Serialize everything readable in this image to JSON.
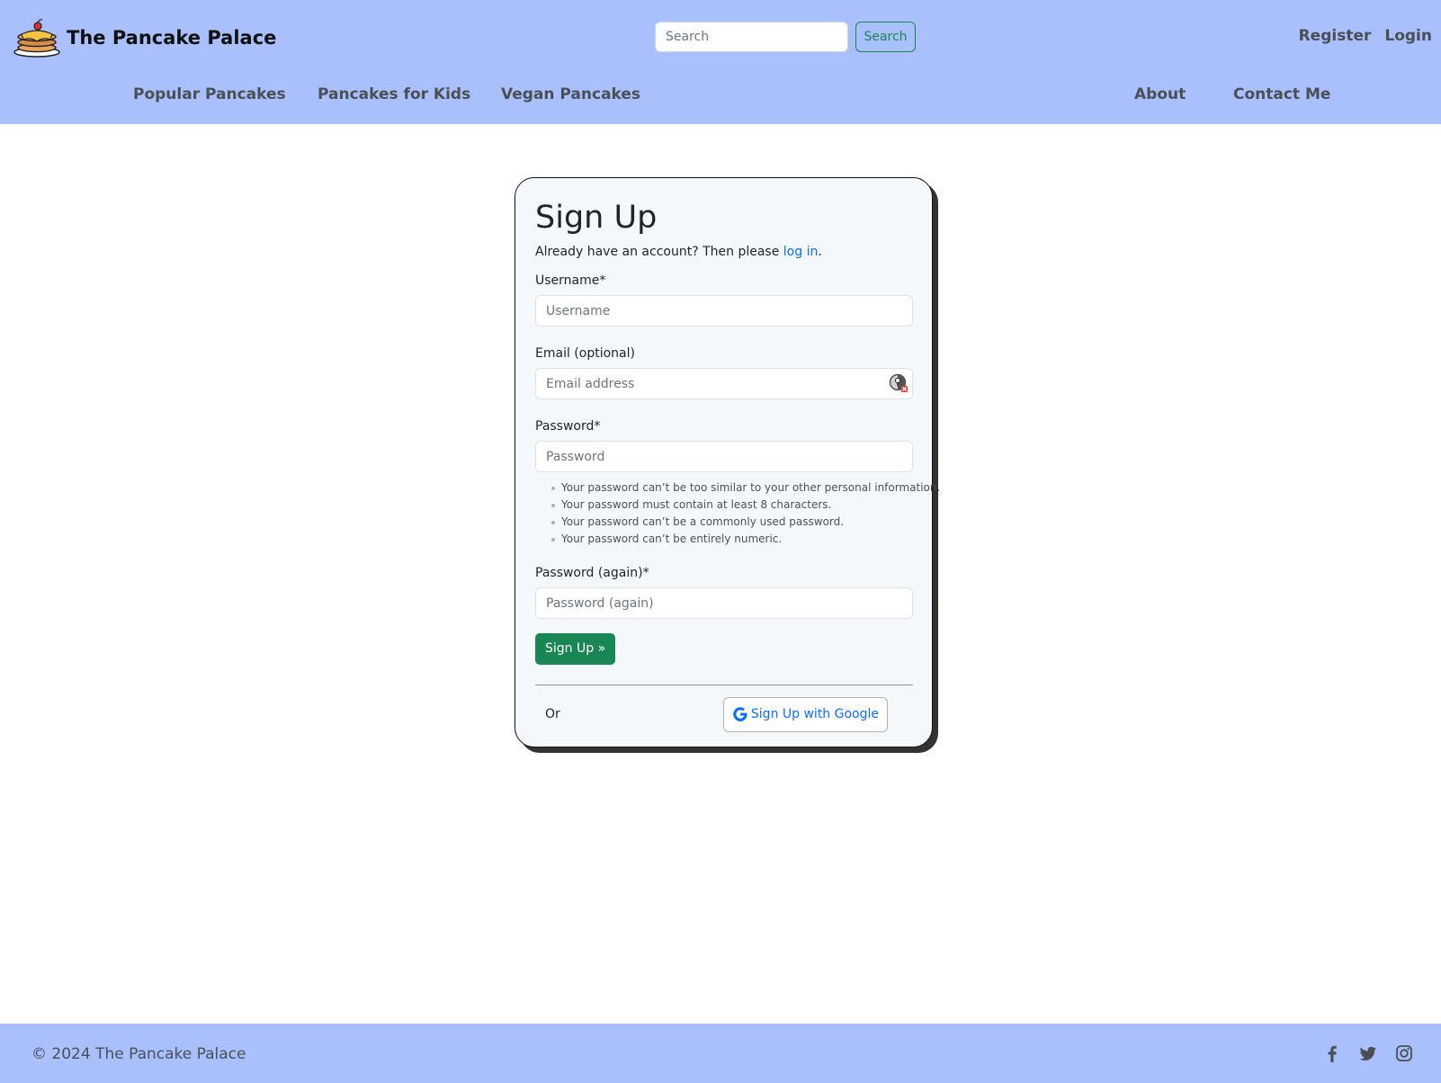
{
  "header": {
    "brand": "The Pancake Palace",
    "search": {
      "placeholder": "Search",
      "button": "Search"
    },
    "auth": {
      "register": "Register",
      "login": "Login"
    },
    "nav": {
      "popular": "Popular Pancakes",
      "kids": "Pancakes for Kids",
      "vegan": "Vegan Pancakes",
      "about": "About",
      "contact": "Contact Me"
    }
  },
  "form": {
    "title": "Sign Up",
    "lead_prefix": "Already have an account? Then please ",
    "lead_link": "log in",
    "lead_suffix": ".",
    "username": {
      "label": "Username*",
      "placeholder": "Username"
    },
    "email": {
      "label": "Email (optional)",
      "placeholder": "Email address"
    },
    "password": {
      "label": "Password*",
      "placeholder": "Password"
    },
    "password_help": [
      "Your password can’t be too similar to your other personal information.",
      "Your password must contain at least 8 characters.",
      "Your password can’t be a commonly used password.",
      "Your password can’t be entirely numeric."
    ],
    "password2": {
      "label": "Password (again)*",
      "placeholder": "Password (again)"
    },
    "submit": "Sign Up »",
    "or": "Or",
    "google": "Sign Up with Google"
  },
  "footer": {
    "copyright": "© 2024 The Pancake Palace"
  },
  "colors": {
    "header_bg": "#aac0fd",
    "primary_green": "#198754",
    "link_blue": "#0d6efd"
  }
}
